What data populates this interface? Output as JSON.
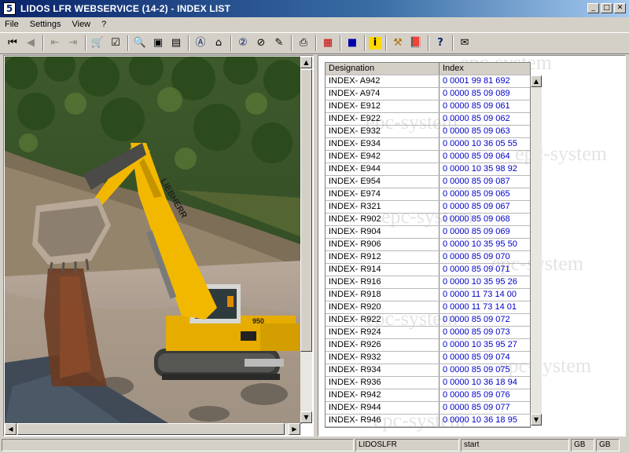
{
  "window": {
    "title": "LIDOS LFR WEBSERVICE (14-2) - INDEX LIST",
    "app_icon_glyph": "5"
  },
  "menu": [
    "File",
    "Settings",
    "View",
    "?"
  ],
  "toolbar_icons": [
    "first-record-icon",
    "previous-record-icon",
    "back-icon",
    "forward-icon",
    "cart-icon",
    "checklist-icon",
    "zoom-in-icon",
    "fit-page-icon",
    "page-icon",
    "search-a-icon",
    "search-home-icon",
    "info-2-icon",
    "search-2-icon",
    "edit-icon",
    "print-icon",
    "grid-icon",
    "select-icon",
    "information-icon",
    "tools-icon",
    "book-icon",
    "help-lidos-icon",
    "mail-icon"
  ],
  "index_table": {
    "columns": [
      "Designation",
      "Index"
    ],
    "rows": [
      [
        "INDEX- A942",
        "0 0001 99 81 692"
      ],
      [
        "INDEX- A974",
        "0 0000 85 09 089"
      ],
      [
        "INDEX- E912",
        "0 0000 85 09 061"
      ],
      [
        "INDEX- E922",
        "0 0000 85 09 062"
      ],
      [
        "INDEX- E932",
        "0 0000 85 09 063"
      ],
      [
        "INDEX- E934",
        "0 0000 10 36 05 55"
      ],
      [
        "INDEX- E942",
        "0 0000 85 09 064"
      ],
      [
        "INDEX- E944",
        "0 0000 10 35 98 92"
      ],
      [
        "INDEX- E954",
        "0 0000 85 09 087"
      ],
      [
        "INDEX- E974",
        "0 0000 85 09 065"
      ],
      [
        "INDEX- R321",
        "0 0000 85 09 067"
      ],
      [
        "INDEX- R902",
        "0 0000 85 09 068"
      ],
      [
        "INDEX- R904",
        "0 0000 85 09 069"
      ],
      [
        "INDEX- R906",
        "0 0000 10 35 95 50"
      ],
      [
        "INDEX- R912",
        "0 0000 85 09 070"
      ],
      [
        "INDEX- R914",
        "0 0000 85 09 071"
      ],
      [
        "INDEX- R916",
        "0 0000 10 35 95 26"
      ],
      [
        "INDEX- R918",
        "0 0000 11 73 14 00"
      ],
      [
        "INDEX- R920",
        "0 0000 11 73 14 01"
      ],
      [
        "INDEX- R922",
        "0 0000 85 09 072"
      ],
      [
        "INDEX- R924",
        "0 0000 85 09 073"
      ],
      [
        "INDEX- R926",
        "0 0000 10 35 95 27"
      ],
      [
        "INDEX- R932",
        "0 0000 85 09 074"
      ],
      [
        "INDEX- R934",
        "0 0000 85 09 075"
      ],
      [
        "INDEX- R936",
        "0 0000 10 36 18 94"
      ],
      [
        "INDEX- R942",
        "0 0000 85 09 076"
      ],
      [
        "INDEX- R944",
        "0 0000 85 09 077"
      ],
      [
        "INDEX- R946",
        "0 0000 10 36 18 95"
      ]
    ]
  },
  "machine_markings": {
    "brand": "LIEBHERR",
    "model": "950"
  },
  "watermark_text": "epc-system",
  "status": {
    "app": "LIDOSLFR",
    "state": "start",
    "lang1": "GB",
    "lang2": "GB"
  },
  "colors": {
    "title_start": "#0a246a",
    "index_text": "#0000cc",
    "machine_yellow": "#f2b800",
    "chrome": "#d4d0c8"
  }
}
